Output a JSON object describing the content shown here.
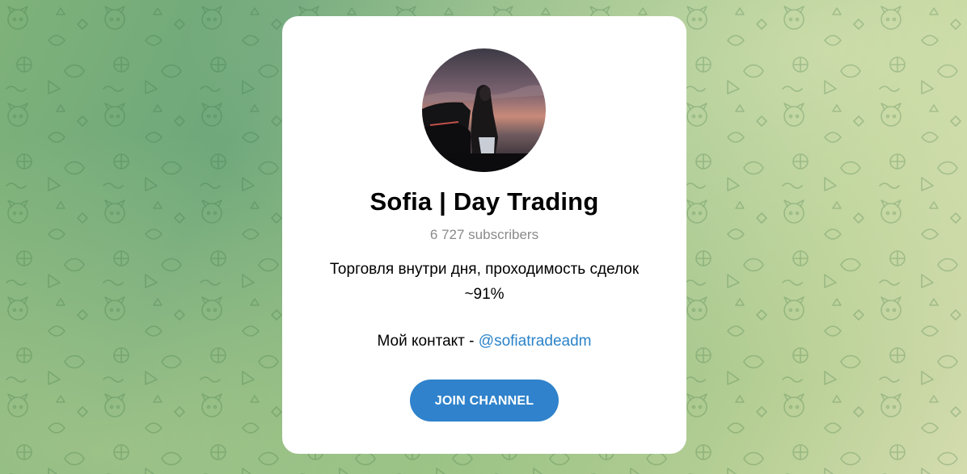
{
  "channel": {
    "title": "Sofia | Day Trading",
    "subscribers": "6 727 subscribers",
    "description_lines": [
      "Торговля внутри дня, проходимость сделок",
      "~91%"
    ],
    "contact_prefix": "Мой контакт - ",
    "contact_handle": "@sofiatradeadm",
    "join_label": "JOIN CHANNEL"
  },
  "colors": {
    "button": "#2f82cb",
    "link": "#2a83c9",
    "subscribers_text": "#8a8a8a"
  },
  "icons": {
    "avatar": "channel-avatar-photo",
    "background": "doodle-pattern"
  }
}
